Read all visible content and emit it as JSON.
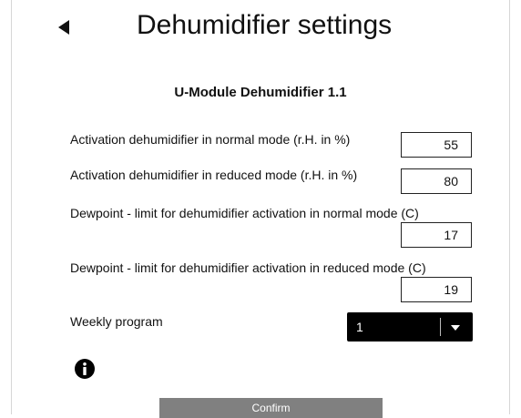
{
  "header": {
    "title": "Dehumidifier settings",
    "back_icon": "back-arrow-icon"
  },
  "section": {
    "title": "U-Module Dehumidifier 1.1"
  },
  "fields": [
    {
      "label": "Activation dehumidifier in normal mode (r.H. in %)",
      "value": "55"
    },
    {
      "label": "Activation dehumidifier in reduced mode (r.H. in %)",
      "value": "80"
    },
    {
      "label": "Dewpoint - limit for dehumidifier activation in normal mode (C)",
      "value": "17"
    },
    {
      "label": "Dewpoint - limit for dehumidifier activation in reduced mode (C)",
      "value": "19"
    }
  ],
  "weekly_program": {
    "label": "Weekly program",
    "selected": "1"
  },
  "info": {
    "icon": "info-icon"
  },
  "confirm": {
    "label": "Confirm"
  },
  "colors": {
    "select_background": "#000000",
    "confirm_background": "#808080",
    "text": "#111111"
  }
}
